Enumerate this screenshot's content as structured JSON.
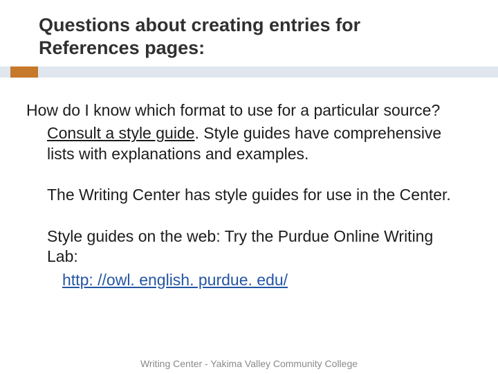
{
  "title": "Questions about creating entries for References pages:",
  "body": {
    "q1": "How do I know which format to use for a particular source?",
    "a1_leadin": "Consult a style guide",
    "a1_rest": ".  Style guides have comprehensive lists with explanations and examples.",
    "p2": "The Writing Center has style guides for use in the Center.",
    "p3": "Style guides on the web:  Try the Purdue Online Writing Lab:",
    "link": "http: //owl. english. purdue. edu/"
  },
  "footer": "Writing Center - Yakima Valley Community College"
}
